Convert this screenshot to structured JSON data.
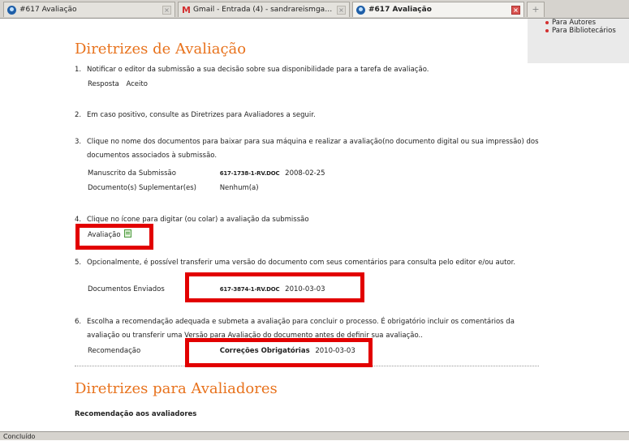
{
  "tabs": [
    {
      "label": "#617 Avaliação",
      "icon": "browser-globe-icon",
      "active": false
    },
    {
      "label": "Gmail - Entrada (4) - sandrareismga@g...",
      "icon": "gmail-icon",
      "active": false
    },
    {
      "label": "#617 Avaliação",
      "icon": "browser-globe-icon",
      "active": true
    }
  ],
  "new_tab_symbol": "+",
  "sidebar": {
    "links": [
      "Para Autores",
      "Para Bibliotecários"
    ]
  },
  "main": {
    "title": "Diretrizes de Avaliação",
    "steps": [
      {
        "num": "1.",
        "text": "Notificar o editor da submissão a sua decisão sobre sua disponibilidade para a tarefa de avaliação."
      },
      {
        "num": "2.",
        "text": "Em caso positivo, consulte as Diretrizes para Avaliadores a seguir."
      },
      {
        "num": "3.",
        "text": "Clique no nome dos documentos para baixar para sua máquina e realizar a avaliação(no documento digital ou sua impressão) dos documentos associados à submissão."
      },
      {
        "num": "4.",
        "text": "Clique no ícone para digitar (ou colar) a avaliação da submissão"
      },
      {
        "num": "5.",
        "text": "Opcionalmente, é possível transferir uma versão do documento com seus comentários para consulta pelo editor e/ou autor."
      },
      {
        "num": "6.",
        "text": "Escolha a recomendação adequada e submeta a avaliação para concluir o processo. É obrigatório incluir os comentários da avaliação ou transferir uma Versão para Avaliação do documento antes de definir sua avaliação.."
      }
    ],
    "step1": {
      "label": "Resposta",
      "value": "Aceito"
    },
    "step3": {
      "manuscript_label": "Manuscrito da Submissão",
      "manuscript_file": "617-1738-1-RV.DOC",
      "manuscript_date": "2008-02-25",
      "supp_label": "Documento(s) Suplementar(es)",
      "supp_value": "Nenhum(a)"
    },
    "step4": {
      "link": "Avaliação",
      "icon": "note-edit-icon"
    },
    "step5": {
      "label": "Documentos Enviados",
      "file": "617-3874-1-RV.DOC",
      "date": "2010-03-03"
    },
    "step6": {
      "label": "Recomendação",
      "value": "Correções Obrigatórias",
      "date": "2010-03-03"
    },
    "section2_title": "Diretrizes para Avaliadores",
    "section2_subtitle": "Recomendação aos avaliadores"
  },
  "status_bar": {
    "text": "Concluído"
  },
  "colors": {
    "heading": "#e8721c",
    "highlight_box": "#e20000",
    "sidebar_bullet": "#d32f2f"
  }
}
